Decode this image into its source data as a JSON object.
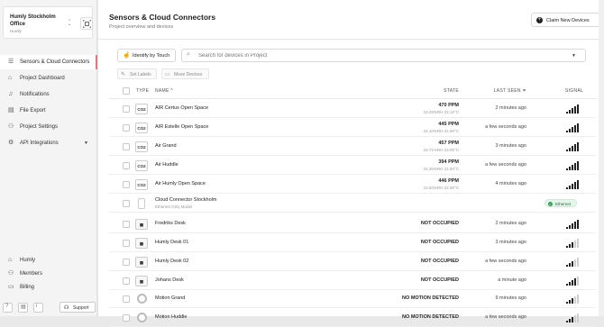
{
  "project": {
    "name": "Humly Stockholm Office",
    "org": "Humly"
  },
  "nav": [
    {
      "label": "Sensors & Cloud Connectors",
      "icon": "list-icon",
      "active": true
    },
    {
      "label": "Project Dashboard",
      "icon": "home-icon"
    },
    {
      "label": "Notifications",
      "icon": "bell-icon"
    },
    {
      "label": "File Export",
      "icon": "file-icon"
    },
    {
      "label": "Project Settings",
      "icon": "users-settings-icon"
    },
    {
      "label": "API Integrations",
      "icon": "api-icon"
    }
  ],
  "nav_bottom": [
    {
      "label": "Humly",
      "icon": "building-icon"
    },
    {
      "label": "Members",
      "icon": "people-icon"
    },
    {
      "label": "Billing",
      "icon": "card-icon"
    }
  ],
  "support_label": "Support",
  "header": {
    "title": "Sensors & Cloud Connectors",
    "subtitle": "Project overview and devices",
    "claim_label": "Claim New Devices"
  },
  "toolbar": {
    "identify_label": "Identify by Touch",
    "search_placeholder": "Search for devices in Project",
    "set_labels": "Set Labels",
    "move_devices": "Move Devices"
  },
  "columns": {
    "type": "TYPE",
    "name": "NAME",
    "state": "STATE",
    "last_seen": "LAST SEEN",
    "signal": "SIGNAL"
  },
  "rows": [
    {
      "type": "co2",
      "type_label": "CO2",
      "name": "AIR Certus Open Space",
      "state": "470 PPM",
      "state_sub": "23.29%RH 23.10°C",
      "last_seen": "2 minutes ago",
      "signal": 5
    },
    {
      "type": "co2",
      "type_label": "CO2",
      "name": "AIR Estelle Open Space",
      "state": "445 PPM",
      "state_sub": "24.10%RH 22.90°C",
      "last_seen": "a few seconds ago",
      "signal": 5
    },
    {
      "type": "co2",
      "type_label": "CO2",
      "name": "Air Grand",
      "state": "457 PPM",
      "state_sub": "23.71%RH 23.00°C",
      "last_seen": "3 minutes ago",
      "signal": 5
    },
    {
      "type": "co2",
      "type_label": "CO2",
      "name": "Air Huddle",
      "state": "394 PPM",
      "state_sub": "24.35%RH 22.60°C",
      "last_seen": "a few seconds ago",
      "signal": 5
    },
    {
      "type": "co2",
      "type_label": "CO2",
      "name": "Air Humly Open Space",
      "state": "446 PPM",
      "state_sub": "23.60%RH 22.80°C",
      "last_seen": "4 minutes ago",
      "signal": 5
    },
    {
      "type": "cc",
      "type_label": "",
      "name": "Cloud Connector Stockholm",
      "name_sub": "Ethernet Only Model",
      "state": "",
      "state_sub": "",
      "last_seen": "",
      "badge": "Ethernet"
    },
    {
      "type": "desk",
      "type_label": "▦",
      "name": "Fredriks Desk",
      "state": "NOT OCCUPIED",
      "state_sub": "",
      "last_seen": "2 minutes ago",
      "signal": 5
    },
    {
      "type": "desk",
      "type_label": "▦",
      "name": "Humly Desk 01",
      "state": "NOT OCCUPIED",
      "state_sub": "",
      "last_seen": "3 minutes ago",
      "signal": 3
    },
    {
      "type": "desk",
      "type_label": "▦",
      "name": "Humly Desk 02",
      "state": "NOT OCCUPIED",
      "state_sub": "",
      "last_seen": "a few seconds ago",
      "signal": 3
    },
    {
      "type": "desk",
      "type_label": "▦",
      "name": "Johans Desk",
      "state": "NOT OCCUPIED",
      "state_sub": "",
      "last_seen": "a minute ago",
      "signal": 4
    },
    {
      "type": "motion",
      "type_label": "",
      "name": "Motion Grand",
      "state": "NO MOTION DETECTED",
      "state_sub": "",
      "last_seen": "9 minutes ago",
      "signal": 3
    },
    {
      "type": "motion",
      "type_label": "",
      "name": "Motion Huddle",
      "state": "NO MOTION DETECTED",
      "state_sub": "",
      "last_seen": "a few seconds ago",
      "signal": 3
    }
  ]
}
